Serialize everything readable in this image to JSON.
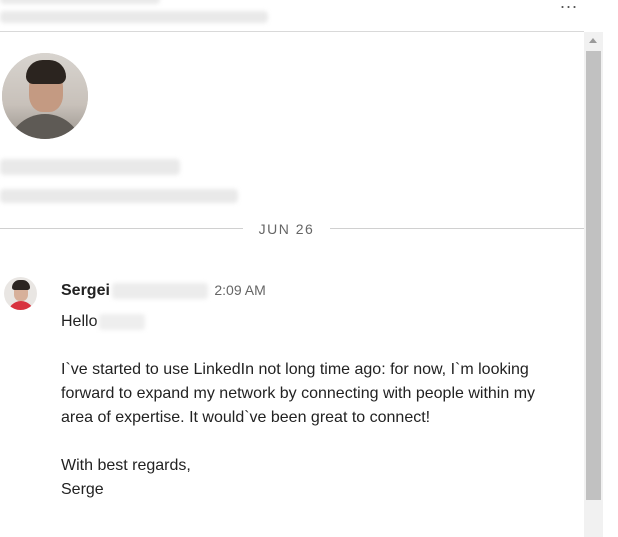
{
  "header": {
    "more_label": "...",
    "more_icon": "more-options-icon"
  },
  "conversation": {
    "date_label": "JUN 26"
  },
  "message": {
    "sender_name": "Sergei",
    "timestamp": "2:09 AM",
    "greeting": "Hello",
    "paragraph1": "I`ve started to use LinkedIn not long time ago: for now, I`m looking forward to expand my network by connecting with people within my area of expertise. It would`ve been great to connect!",
    "signoff": "With best regards,",
    "signature": "Serge"
  },
  "scrollbar": {
    "up_icon": "scroll-up-arrow-icon"
  }
}
